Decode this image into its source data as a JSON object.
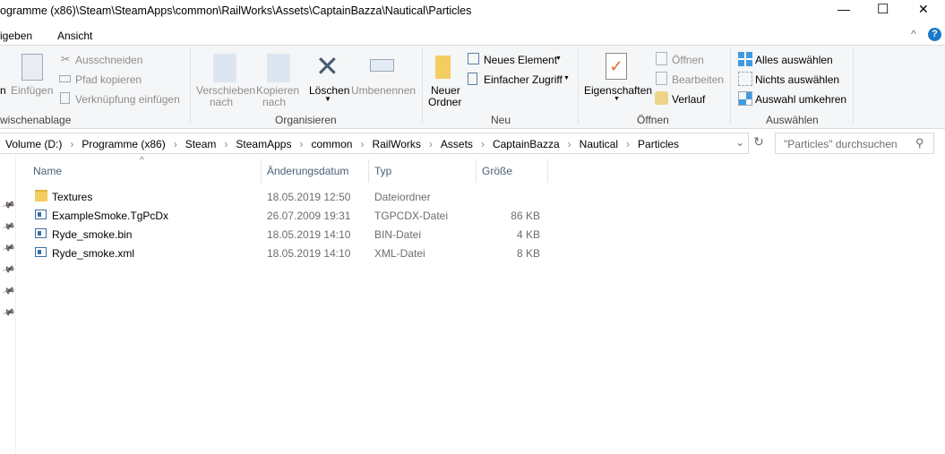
{
  "window": {
    "title": "ogramme (x86)\\Steam\\SteamApps\\common\\RailWorks\\Assets\\CaptainBazza\\Nautical\\Particles",
    "minimize": "—",
    "maximize": "☐",
    "close": "✕"
  },
  "tabs": [
    {
      "label": "igeben"
    },
    {
      "label": "Ansicht"
    }
  ],
  "ribbon": {
    "collapse": "^",
    "help": "?",
    "clipboard": {
      "pin_partial": "n",
      "paste": "Einfügen",
      "cut": "Ausschneiden",
      "copy_path": "Pfad kopieren",
      "paste_shortcut": "Verknüpfung einfügen",
      "label": "wischenablage"
    },
    "organize": {
      "move_to": "Verschieben",
      "move_to2": "nach",
      "copy_to": "Kopieren",
      "copy_to2": "nach",
      "delete": "Löschen",
      "rename": "Umbenennen",
      "label": "Organisieren"
    },
    "new": {
      "new_folder": "Neuer",
      "new_folder2": "Ordner",
      "new_item": "Neues Element",
      "easy_access": "Einfacher Zugriff",
      "label": "Neu"
    },
    "open": {
      "properties": "Eigenschaften",
      "open": "Öffnen",
      "edit": "Bearbeiten",
      "history": "Verlauf",
      "label": "Öffnen"
    },
    "select": {
      "select_all": "Alles auswählen",
      "select_none": "Nichts auswählen",
      "invert": "Auswahl umkehren",
      "label": "Auswählen"
    }
  },
  "address": {
    "crumbs": [
      "Volume (D:)",
      "Programme (x86)",
      "Steam",
      "SteamApps",
      "common",
      "RailWorks",
      "Assets",
      "CaptainBazza",
      "Nautical",
      "Particles"
    ],
    "search_placeholder": "\"Particles\" durchsuchen"
  },
  "columns": {
    "name": "Name",
    "date": "Änderungsdatum",
    "type": "Typ",
    "size": "Größe"
  },
  "files": [
    {
      "name": "Textures",
      "date": "18.05.2019 12:50",
      "type": "Dateiordner",
      "size": "",
      "icon": "folder-icon"
    },
    {
      "name": "ExampleSmoke.TgPcDx",
      "date": "26.07.2009 19:31",
      "type": "TGPCDX-Datei",
      "size": "86 KB",
      "icon": "file-icon"
    },
    {
      "name": "Ryde_smoke.bin",
      "date": "18.05.2019 14:10",
      "type": "BIN-Datei",
      "size": "4 KB",
      "icon": "file-icon"
    },
    {
      "name": "Ryde_smoke.xml",
      "date": "18.05.2019 14:10",
      "type": "XML-Datei",
      "size": "8 KB",
      "icon": "file-icon"
    }
  ]
}
